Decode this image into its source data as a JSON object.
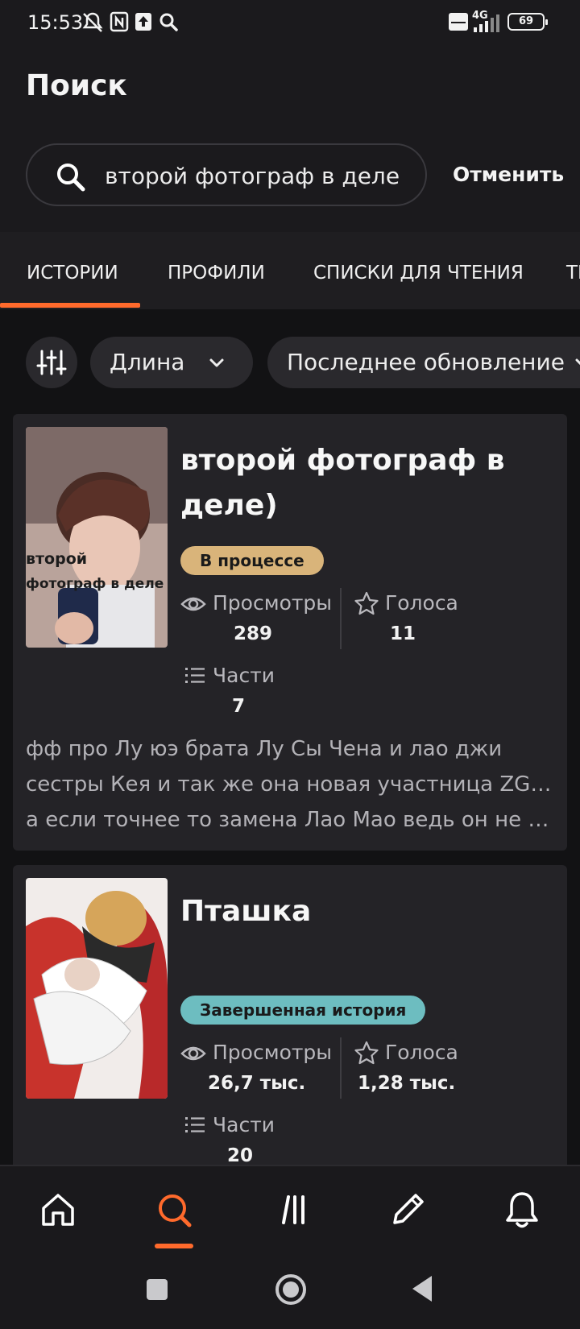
{
  "status_bar": {
    "time": "15:53",
    "network": "4G",
    "battery": "69"
  },
  "header": {
    "title": "Поиск",
    "search_value": "второй фотограф в деле",
    "cancel_label": "Отменить"
  },
  "tabs": [
    {
      "label": "ИСТОРИИ",
      "active": true
    },
    {
      "label": "ПРОФИЛИ",
      "active": false
    },
    {
      "label": "СПИСКИ ДЛЯ ЧТЕНИЯ",
      "active": false
    },
    {
      "label": "ТЕГИ",
      "active": false
    }
  ],
  "filters": {
    "length_label": "Длина",
    "updated_label": "Последнее обновление"
  },
  "stories": [
    {
      "title": "второй фотограф в деле)",
      "status": "В процессе",
      "status_color": "#d9b47a",
      "cover_text": [
        "второй",
        "фотограф в деле"
      ],
      "views_label": "Просмотры",
      "views": "289",
      "votes_label": "Голоса",
      "votes": "11",
      "parts_label": "Части",
      "parts": "7",
      "description": [
        "фф про Лу юэ брата Лу Сы Чена и лао джи",
        "сестры Кея и так же она новая участница ZGDX",
        "а если точнее то замена Лао Мао ведь он не …"
      ]
    },
    {
      "title": "Пташка",
      "status": "Завершенная история",
      "status_color": "#6dbdc0",
      "views_label": "Просмотры",
      "views": "26,7 тыс.",
      "votes_label": "Голоса",
      "votes": "1,28 тыс.",
      "parts_label": "Части",
      "parts": "20"
    }
  ],
  "bottom_nav": [
    "home-icon",
    "search-icon",
    "library-icon",
    "write-icon",
    "bell-icon"
  ],
  "accent_color": "#ff6a2c"
}
